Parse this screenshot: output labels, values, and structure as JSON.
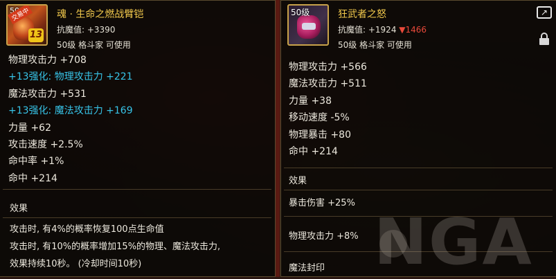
{
  "left_item": {
    "level_tag": "50",
    "trade_tag": "交易中",
    "enhance_badge": "13",
    "name": "魂 · 生命之燃战臂铠",
    "resist": "抗魔值: +3390",
    "requirement": "50级 格斗家 可使用",
    "stats": [
      {
        "text": "物理攻击力 +708",
        "enhanced": false
      },
      {
        "text": "+13强化: 物理攻击力 +221",
        "enhanced": true
      },
      {
        "text": "魔法攻击力 +531",
        "enhanced": false
      },
      {
        "text": "+13强化: 魔法攻击力 +169",
        "enhanced": true
      },
      {
        "text": "力量 +62",
        "enhanced": false
      },
      {
        "text": "攻击速度 +2.5%",
        "enhanced": false
      },
      {
        "text": "命中率 +1%",
        "enhanced": false
      },
      {
        "text": "命中 +214",
        "enhanced": false
      }
    ],
    "effect_title": "效果",
    "effect_lines": [
      "攻击时, 有4%的概率恢复100点生命值",
      "攻击时, 有10%的概率增加15%的物理、魔法攻击力,",
      "效果持续10秒。 (冷却时间10秒)"
    ]
  },
  "right_item": {
    "level_tag": "50级",
    "name": "狂武者之怒",
    "resist_prefix": "抗魔值: +1924",
    "resist_change": "▼1466",
    "requirement": "50级 格斗家 可使用",
    "stats": [
      "物理攻击力 +566",
      "魔法攻击力 +511",
      "力量 +38",
      "移动速度 -5%",
      "物理暴击 +80",
      "命中 +214"
    ],
    "effect_title": "效果",
    "effect_line1": "暴击伤害 +25%",
    "effect_line2": "物理攻击力 +8%",
    "seal_title": "魔法封印"
  },
  "watermark": "NGA",
  "colors": {
    "name_gold": "#f2c94c",
    "enhance_cyan": "#37c4e8",
    "decrease_red": "#e8493a"
  },
  "icons": {
    "share": "share-icon",
    "lock": "lock-icon"
  }
}
